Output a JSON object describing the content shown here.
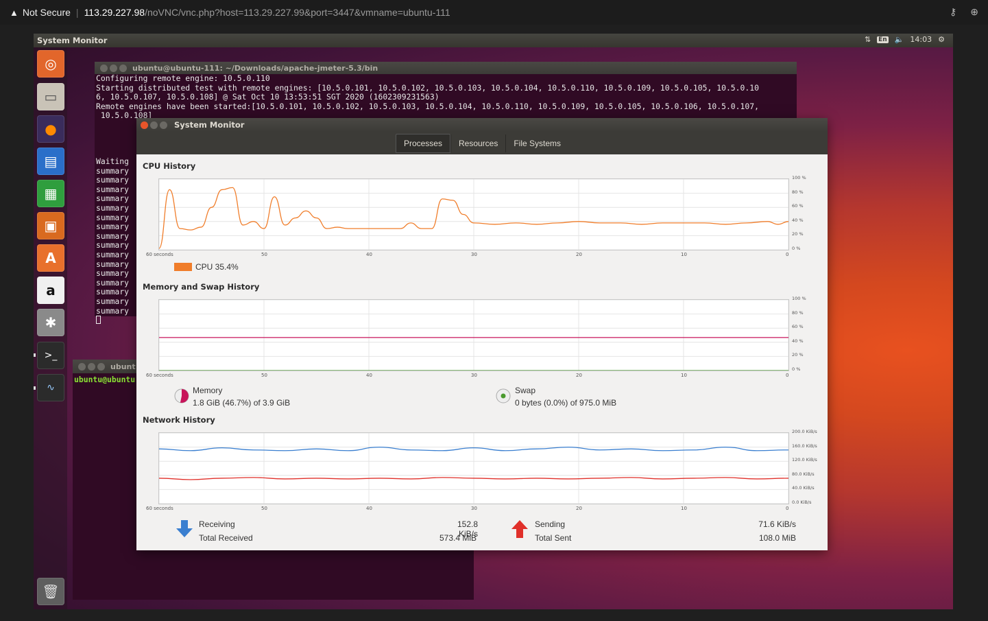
{
  "browser": {
    "warning": "Not Secure",
    "host": "113.29.227.98",
    "path": "/noVNC/vnc.php?host=113.29.227.99&port=3447&vmname=ubuntu-111"
  },
  "topbar": {
    "title": "System Monitor",
    "lang": "En",
    "clock": "14:03"
  },
  "terminal": {
    "title": "ubuntu@ubuntu-111: ~/Downloads/apache-jmeter-5.3/bin",
    "lines": [
      "Configuring remote engine: 10.5.0.110",
      "Starting distributed test with remote engines: [10.5.0.101, 10.5.0.102, 10.5.0.103, 10.5.0.104, 10.5.0.110, 10.5.0.109, 10.5.0.105, 10.5.0.10",
      "6, 10.5.0.107, 10.5.0.108] @ Sat Oct 10 13:53:51 SGT 2020 (1602309231563)",
      "Remote engines have been started:[10.5.0.101, 10.5.0.102, 10.5.0.103, 10.5.0.104, 10.5.0.110, 10.5.0.109, 10.5.0.105, 10.5.0.106, 10.5.0.107,",
      " 10.5.0.108]"
    ],
    "left_lines": [
      "Waiting",
      "summary",
      "summary",
      "summary",
      "summary",
      "summary",
      "summary",
      "summary",
      "summary",
      "summary",
      "summary",
      "summary",
      "summary",
      "summary",
      "summary",
      "summary",
      "summary"
    ]
  },
  "terminal2": {
    "title": "ubunt",
    "prompt": "ubuntu@ubuntu"
  },
  "sysmon": {
    "title": "System Monitor",
    "tabs": [
      "Processes",
      "Resources",
      "File Systems"
    ],
    "cpu": {
      "heading": "CPU History",
      "legend": "CPU 35.4%",
      "color": "#f07d2a"
    },
    "mem": {
      "heading": "Memory and Swap History",
      "memory_label": "Memory",
      "memory_value": "1.8 GiB (46.7%) of 3.9 GiB",
      "swap_label": "Swap",
      "swap_value": "0 bytes (0.0%) of 975.0 MiB",
      "memory_color": "#c8155b",
      "swap_color": "#4a9a2e"
    },
    "net": {
      "heading": "Network History",
      "receiving_label": "Receiving",
      "receiving_value": "152.8 KiB/s",
      "total_received_label": "Total Received",
      "total_received_value": "573.4 MiB",
      "sending_label": "Sending",
      "sending_value": "71.6 KiB/s",
      "total_sent_label": "Total Sent",
      "total_sent_value": "108.0 MiB",
      "recv_color": "#3a7fd0",
      "send_color": "#e0302a"
    },
    "x_ticks": [
      "60 seconds",
      "50",
      "40",
      "30",
      "20",
      "10",
      "0"
    ],
    "pct_ticks": [
      "100 %",
      "80 %",
      "60 %",
      "40 %",
      "20 %",
      "0 %"
    ],
    "net_ticks": [
      "200.0 KiB/s",
      "160.0 KiB/s",
      "120.0 KiB/s",
      "80.0 KiB/s",
      "40.0 KiB/s",
      "0.0 KiB/s"
    ]
  },
  "chart_data": [
    {
      "type": "line",
      "title": "CPU History",
      "x": [
        60,
        59,
        58,
        57,
        56,
        55,
        54,
        53,
        52,
        51,
        50,
        49,
        48,
        47,
        46,
        45,
        44,
        43,
        42,
        41,
        40,
        39,
        38,
        37,
        36,
        35,
        34,
        33,
        32,
        31,
        30,
        28,
        26,
        24,
        22,
        20,
        18,
        16,
        14,
        12,
        10,
        8,
        6,
        4,
        2,
        1,
        0
      ],
      "series": [
        {
          "name": "CPU",
          "values": [
            2,
            85,
            30,
            28,
            32,
            60,
            85,
            88,
            35,
            40,
            30,
            75,
            35,
            45,
            55,
            45,
            30,
            32,
            30,
            30,
            30,
            30,
            30,
            30,
            38,
            30,
            30,
            72,
            70,
            50,
            38,
            36,
            38,
            36,
            38,
            40,
            38,
            38,
            36,
            38,
            38,
            38,
            36,
            38,
            40,
            36,
            40
          ]
        }
      ],
      "ylim": [
        0,
        100
      ]
    },
    {
      "type": "line",
      "title": "Memory and Swap History",
      "x": [
        60,
        0
      ],
      "series": [
        {
          "name": "Memory",
          "values": [
            46.7,
            46.7
          ]
        },
        {
          "name": "Swap",
          "values": [
            0,
            0
          ]
        }
      ],
      "ylim": [
        0,
        100
      ]
    },
    {
      "type": "line",
      "title": "Network History",
      "x": [
        60,
        57,
        54,
        51,
        48,
        45,
        42,
        39,
        36,
        33,
        30,
        27,
        24,
        21,
        18,
        15,
        12,
        9,
        6,
        3,
        0
      ],
      "series": [
        {
          "name": "Receiving",
          "values": [
            155,
            150,
            158,
            152,
            150,
            155,
            150,
            160,
            152,
            150,
            158,
            150,
            155,
            160,
            152,
            155,
            150,
            152,
            160,
            150,
            152
          ]
        },
        {
          "name": "Sending",
          "values": [
            72,
            68,
            72,
            74,
            70,
            72,
            70,
            72,
            70,
            74,
            72,
            70,
            72,
            70,
            72,
            74,
            70,
            72,
            74,
            70,
            72
          ]
        }
      ],
      "ylim": [
        0,
        200
      ]
    }
  ]
}
